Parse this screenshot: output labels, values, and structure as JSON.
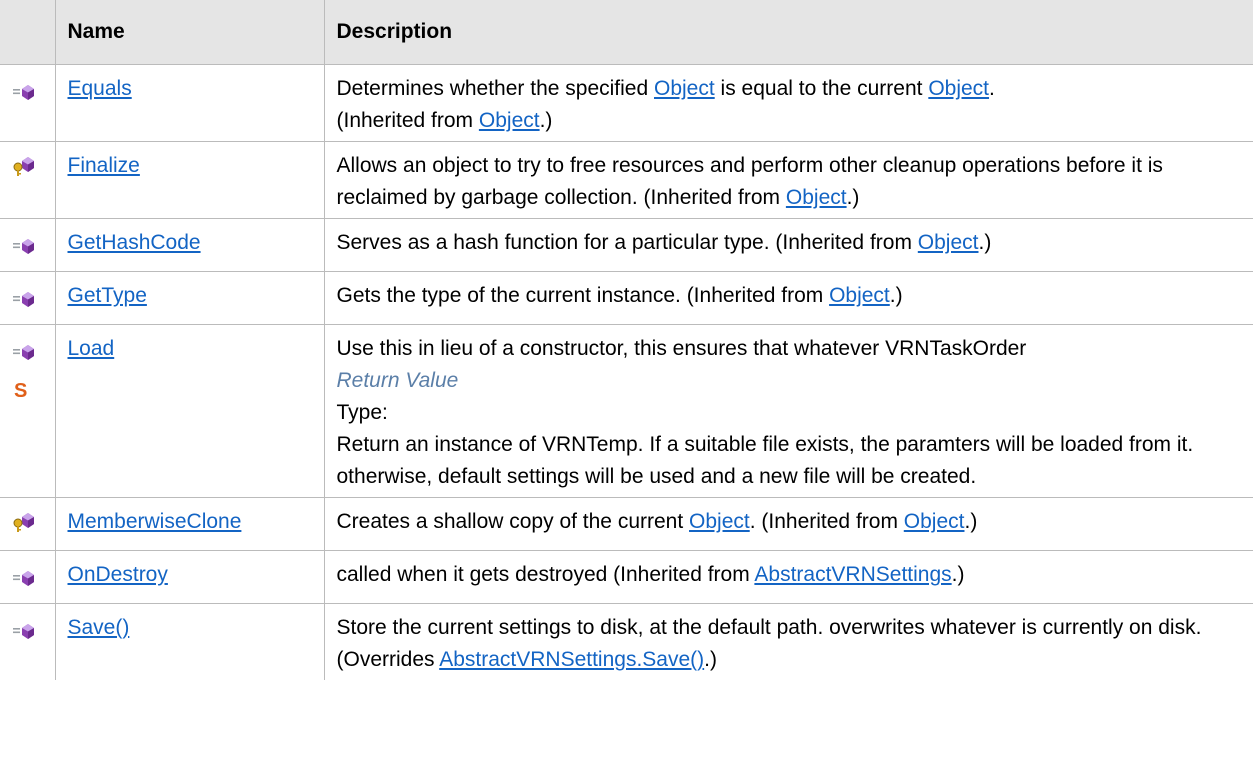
{
  "headers": {
    "icon": "",
    "name": "Name",
    "description": "Description"
  },
  "icons": {
    "public_method": "public-method-icon",
    "protected_method": "protected-method-icon",
    "static": "static-icon"
  },
  "rows": [
    {
      "icon": "public-method-icon",
      "name": "Equals",
      "desc": [
        "Determines whether the specified ",
        {
          "link": "Object"
        },
        " is equal to the current ",
        {
          "link": "Object"
        },
        ".\n(Inherited from ",
        {
          "link": "Object"
        },
        ".)"
      ]
    },
    {
      "icon": "protected-method-icon",
      "name": "Finalize",
      "desc": [
        "Allows an object to try to free resources and perform other cleanup operations before it is reclaimed by garbage collection. (Inherited from ",
        {
          "link": "Object"
        },
        ".)"
      ]
    },
    {
      "icon": "public-method-icon",
      "name": "GetHashCode",
      "desc": [
        "Serves as a hash function for a particular type. (Inherited from ",
        {
          "link": "Object"
        },
        ".)"
      ]
    },
    {
      "icon": "public-method-icon",
      "name": "GetType",
      "desc": [
        "Gets the type of the current instance. (Inherited from ",
        {
          "link": "Object"
        },
        ".)"
      ]
    },
    {
      "icon": "public-method-icon",
      "static": true,
      "name": "Load",
      "desc": [
        "Use this in lieu of a constructor, this ensures that whatever VRNTaskOrder\n",
        {
          "italic": "Return Value"
        },
        "\nType:\nReturn an instance of VRNTemp. If a suitable file exists, the paramters will be loaded from it. otherwise, default settings will be used and a new file will be created."
      ]
    },
    {
      "icon": "protected-method-icon",
      "name": "MemberwiseClone",
      "desc": [
        "Creates a shallow copy of the current ",
        {
          "link": "Object"
        },
        ". (Inherited from ",
        {
          "link": "Object"
        },
        ".)"
      ]
    },
    {
      "icon": "public-method-icon",
      "name": "OnDestroy",
      "desc": [
        "called when it gets destroyed (Inherited from ",
        {
          "link": "AbstractVRNSettings"
        },
        ".)"
      ]
    },
    {
      "icon": "public-method-icon",
      "name": "Save()",
      "desc": [
        "Store the current settings to disk, at the default path. overwrites whatever is currently on disk. (Overrides ",
        {
          "link": "AbstractVRNSettings.Save()"
        },
        ".)"
      ]
    }
  ]
}
